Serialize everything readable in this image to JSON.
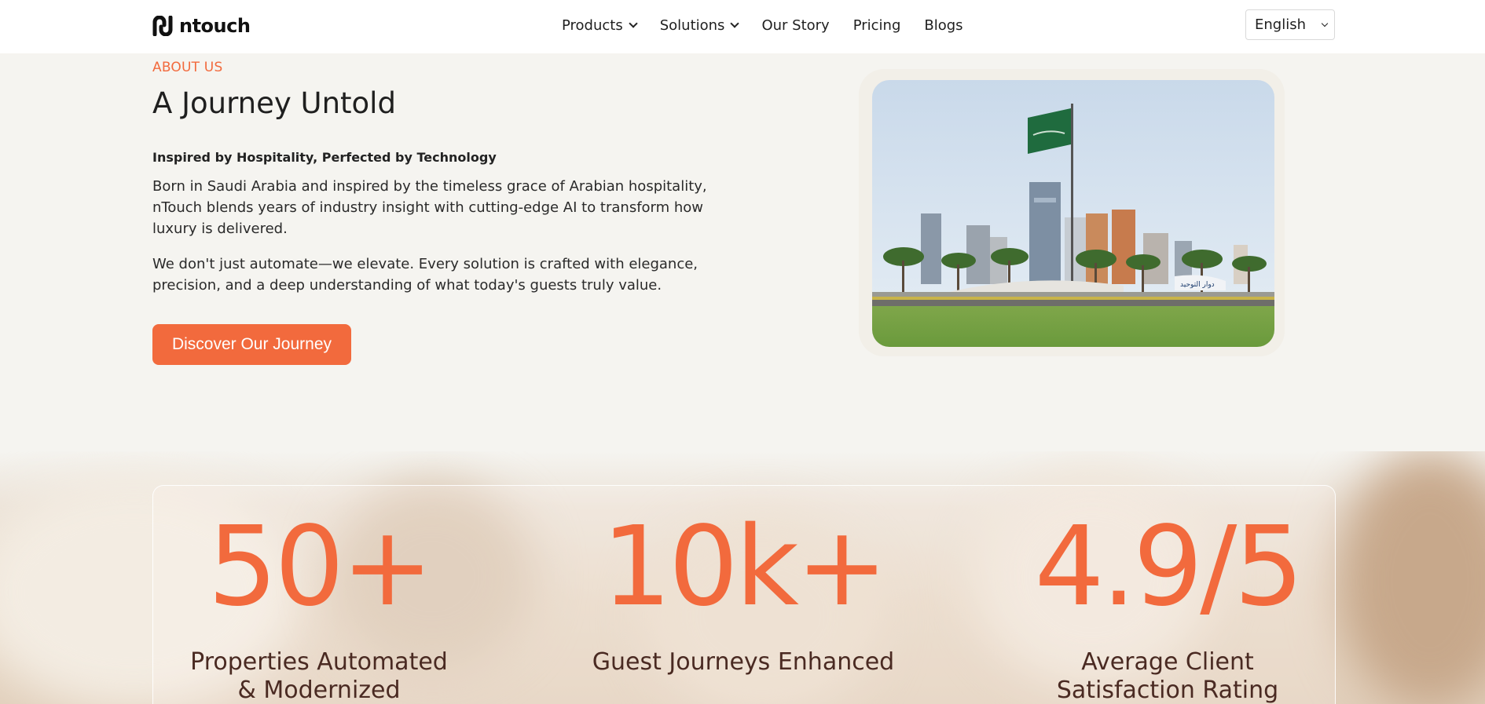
{
  "header": {
    "logo_text": "ntouch",
    "nav": [
      {
        "label": "Products",
        "has_dropdown": true
      },
      {
        "label": "Solutions",
        "has_dropdown": true
      },
      {
        "label": "Our Story",
        "has_dropdown": false
      },
      {
        "label": "Pricing",
        "has_dropdown": false
      },
      {
        "label": "Blogs",
        "has_dropdown": false
      }
    ],
    "language": "English"
  },
  "about": {
    "eyebrow": "ABOUT US",
    "title": "A Journey Untold",
    "subtitle": "Inspired by Hospitality, Perfected by Technology",
    "paragraph1": "Born in Saudi Arabia and inspired by the timeless grace of Arabian hospitality, nTouch blends years of industry insight with cutting-edge AI to transform how luxury is delivered.",
    "paragraph2": "We don't just automate—we elevate. Every solution is crafted with elegance, precision, and a deep understanding of what today's guests truly value.",
    "cta_label": "Discover Our Journey",
    "image_sign_text": "دوار التوحيد"
  },
  "stats": [
    {
      "value": "50+",
      "label": "Properties Automated & Modernized"
    },
    {
      "value": "10k+",
      "label": "Guest Journeys Enhanced"
    },
    {
      "value": "4.9/5",
      "label": "Average Client Satisfaction Rating"
    }
  ],
  "colors": {
    "accent": "#f26a3d",
    "background": "#f5f4f0",
    "stat_label": "#4a2a22"
  }
}
